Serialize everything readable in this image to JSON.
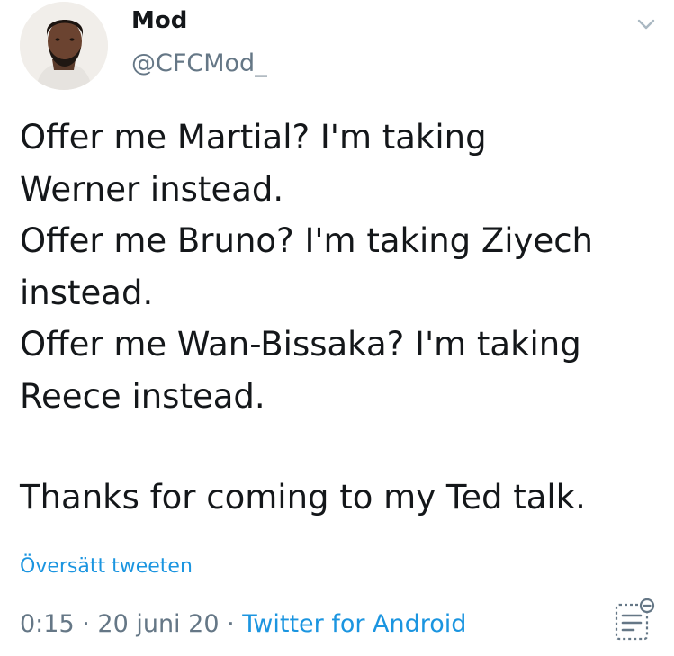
{
  "author": {
    "display_name": "Mod",
    "handle": "@CFCMod_",
    "avatar_icon": "profile-photo"
  },
  "tweet": {
    "lines": [
      "Offer me Martial? I'm taking",
      "Werner instead.",
      "Offer me Bruno? I'm taking Ziyech",
      "instead.",
      "Offer me Wan-Bissaka? I'm taking",
      "Reece instead."
    ],
    "closing_line": "Thanks for coming to my Ted talk."
  },
  "translate_label": "Översätt tweeten",
  "meta": {
    "time": "0:15",
    "separator": " · ",
    "date": "20 juni 20",
    "source": "Twitter for Android"
  },
  "icons": {
    "menu": "chevron-down-icon",
    "analytics": "tweet-analytics-icon"
  },
  "colors": {
    "link": "#1b95e0",
    "secondary_text": "#657786",
    "primary_text": "#14171a"
  }
}
